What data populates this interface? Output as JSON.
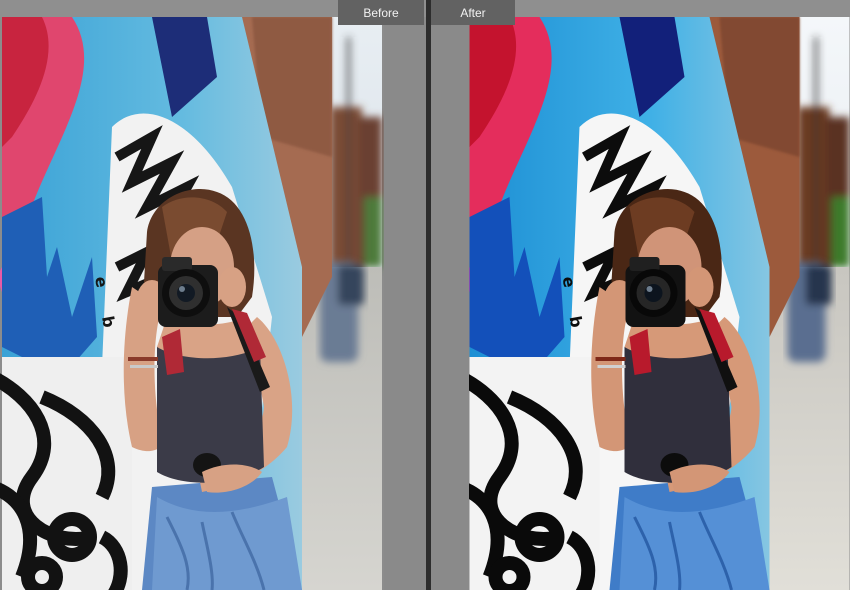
{
  "comparison": {
    "before_label": "Before",
    "after_label": "After"
  },
  "colors": {
    "chrome_bg": "#8c8c8c",
    "label_bg": "#626262",
    "label_text": "#f2f2f2",
    "divider": "#2d2d2d"
  }
}
